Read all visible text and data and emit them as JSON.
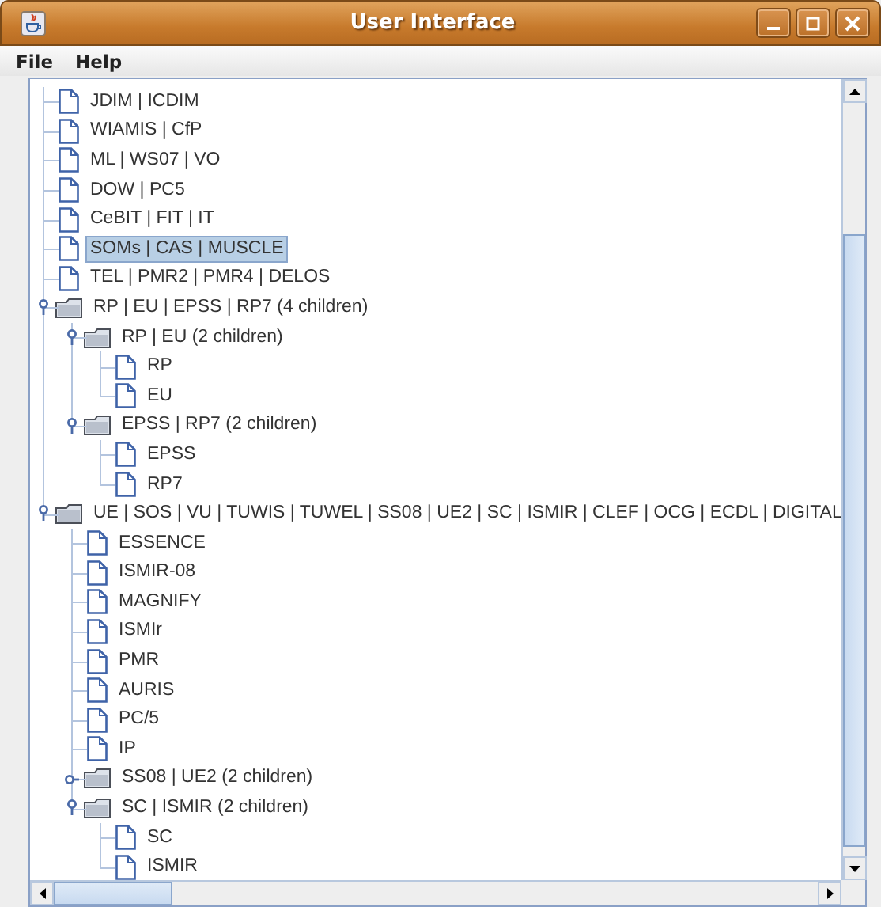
{
  "window": {
    "title": "User Interface"
  },
  "menu": [
    "File",
    "Help"
  ],
  "tree": [
    {
      "kind": "leaf",
      "label": "JDIM | ICDIM",
      "selected": false
    },
    {
      "kind": "leaf",
      "label": "WIAMIS | CfP",
      "selected": false
    },
    {
      "kind": "leaf",
      "label": "ML | WS07 | VO",
      "selected": false
    },
    {
      "kind": "leaf",
      "label": "DOW | PC5",
      "selected": false
    },
    {
      "kind": "leaf",
      "label": "CeBIT | FIT | IT",
      "selected": false
    },
    {
      "kind": "leaf",
      "label": "SOMs | CAS | MUSCLE",
      "selected": true
    },
    {
      "kind": "leaf",
      "label": "TEL | PMR2 | PMR4 | DELOS",
      "selected": false
    },
    {
      "kind": "folder",
      "label": "RP | EU | EPSS | RP7 (4 children)",
      "selected": false,
      "expanded": true,
      "children": [
        {
          "kind": "folder",
          "label": "RP | EU (2 children)",
          "selected": false,
          "expanded": true,
          "children": [
            {
              "kind": "leaf",
              "label": "RP",
              "selected": false
            },
            {
              "kind": "leaf",
              "label": "EU",
              "selected": false
            }
          ]
        },
        {
          "kind": "folder",
          "label": "EPSS | RP7 (2 children)",
          "selected": false,
          "expanded": true,
          "children": [
            {
              "kind": "leaf",
              "label": "EPSS",
              "selected": false
            },
            {
              "kind": "leaf",
              "label": "RP7",
              "selected": false
            }
          ]
        }
      ]
    },
    {
      "kind": "folder",
      "label": "UE | SOS | VU | TUWIS | TUWEL | SS08 | UE2 | SC | ISMIR | CLEF | OCG | ECDL | DIGITAL",
      "selected": false,
      "expanded": true,
      "children": [
        {
          "kind": "leaf",
          "label": "ESSENCE",
          "selected": false
        },
        {
          "kind": "leaf",
          "label": "ISMIR-08",
          "selected": false
        },
        {
          "kind": "leaf",
          "label": "MAGNIFY",
          "selected": false
        },
        {
          "kind": "leaf",
          "label": "ISMIr",
          "selected": false
        },
        {
          "kind": "leaf",
          "label": "PMR",
          "selected": false
        },
        {
          "kind": "leaf",
          "label": "AURIS",
          "selected": false
        },
        {
          "kind": "leaf",
          "label": "PC/5",
          "selected": false
        },
        {
          "kind": "leaf",
          "label": "IP",
          "selected": false
        },
        {
          "kind": "folder",
          "label": "SS08 | UE2 (2 children)",
          "selected": false,
          "expanded": false
        },
        {
          "kind": "folder",
          "label": "SC | ISMIR (2 children)",
          "selected": false,
          "expanded": true,
          "children": [
            {
              "kind": "leaf",
              "label": "SC",
              "selected": false
            },
            {
              "kind": "leaf",
              "label": "ISMIR",
              "selected": false
            }
          ]
        }
      ]
    }
  ]
}
